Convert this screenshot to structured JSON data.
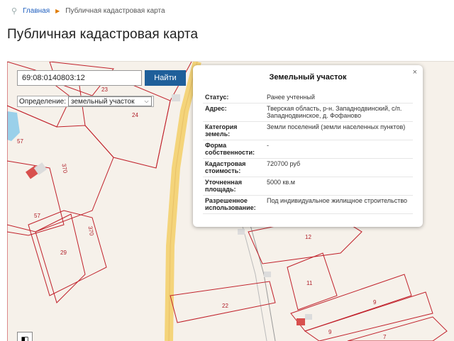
{
  "breadcrumb": {
    "home_label": "Главная",
    "current_label": "Публичная кадастровая карта"
  },
  "page": {
    "title": "Публичная кадастровая карта"
  },
  "search": {
    "value": "69:08:0140803:12",
    "button_label": "Найти"
  },
  "definition": {
    "label": "Определение:",
    "selected": "земельный участок"
  },
  "popup": {
    "title": "Земельный участок",
    "close_symbol": "×",
    "rows": [
      {
        "key": "Статус:",
        "value": "Ранее учтенный"
      },
      {
        "key": "Адрес:",
        "value": "Тверская область, р-н. Западнодвинский, с/п. Западнодвинское, д. Фофаново"
      },
      {
        "key": "Категория земель:",
        "value": "Земли поселений (земли населенных пунктов)"
      },
      {
        "key": "Форма собственности:",
        "value": "-"
      },
      {
        "key": "Кадастровая стоимость:",
        "value": "720700 руб"
      },
      {
        "key": "Уточненная площадь:",
        "value": "5000 кв.м"
      },
      {
        "key": "Разрешенное использование:",
        "value": "Под индивидуальное жилищное строительство"
      }
    ]
  },
  "map": {
    "parcel_labels": [
      "23",
      "24",
      "57",
      "370",
      "57",
      "370",
      "29",
      "22",
      "12",
      "11",
      "9",
      "9",
      "7"
    ]
  },
  "colors": {
    "accent": "#1f5f9a",
    "parcel_border": "#c0202a",
    "road": "#f4d47a"
  }
}
